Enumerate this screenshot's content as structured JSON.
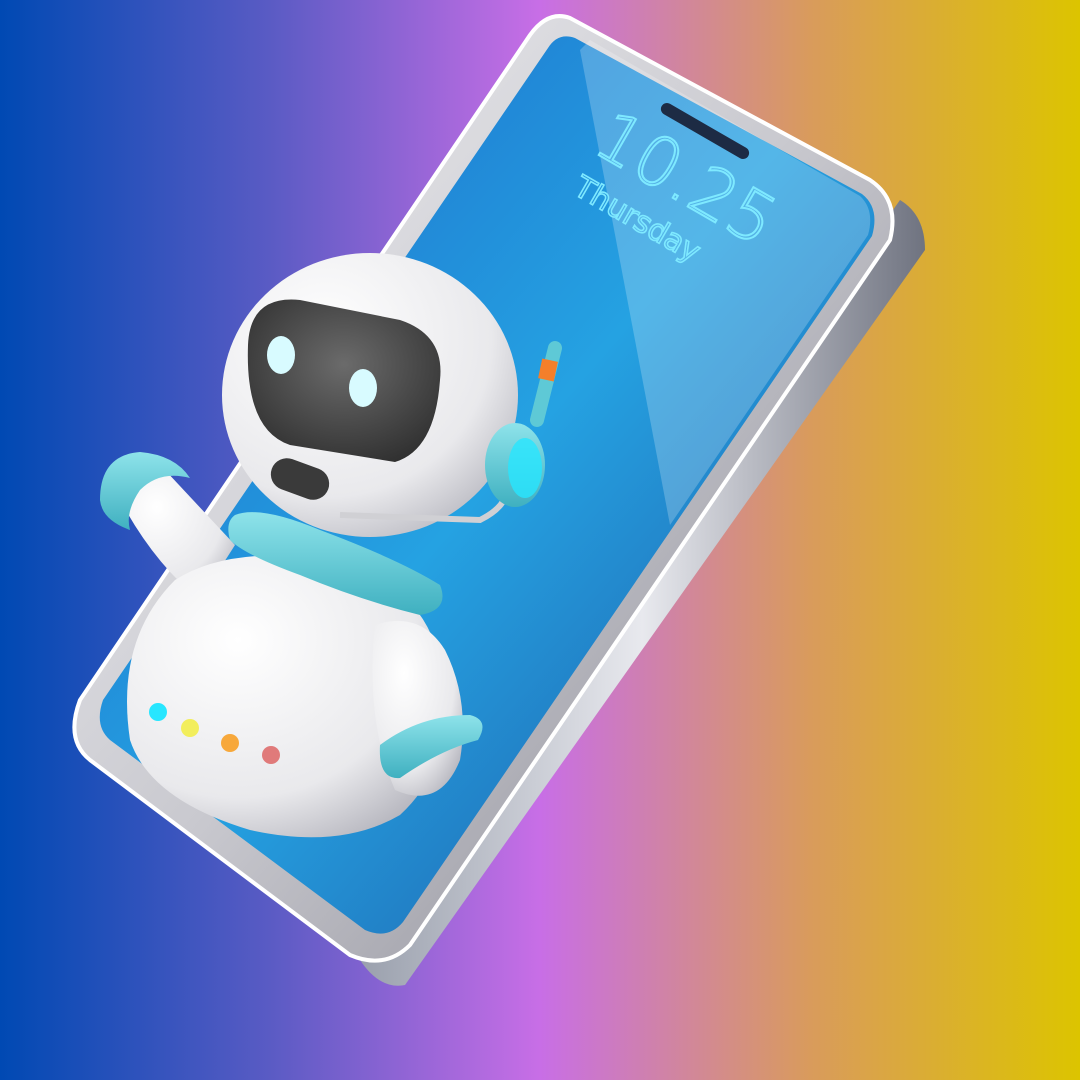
{
  "lock_screen": {
    "time": "10.25",
    "day": "Thursday"
  },
  "colors": {
    "background_left": "#0049b3",
    "background_mid": "#c86ee6",
    "background_right": "#dcc400",
    "screen": "#2a9ee0",
    "robot_body": "#f2f2f2",
    "robot_accent": "#5ec9d6",
    "visor": "#4a4a4a",
    "eyes": "#d8fbff"
  },
  "robot": {
    "indicator_lights": [
      "#27e6ff",
      "#f2ee5c",
      "#f7a83b",
      "#e07a7a"
    ]
  }
}
